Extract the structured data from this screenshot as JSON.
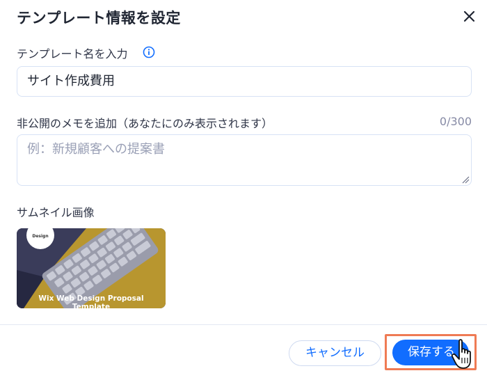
{
  "dialog": {
    "title": "テンプレート情報を設定"
  },
  "name_field": {
    "label": "テンプレート名を入力",
    "value": "サイト作成費用"
  },
  "memo_field": {
    "label": "非公開のメモを追加（あなたにのみ表示されます）",
    "counter": "0/300",
    "placeholder": "例：新規顧客への提案書"
  },
  "thumbnail": {
    "label": "サムネイル画像",
    "logo_text": "Design",
    "caption_line1": "Wix Web Design Proposal",
    "caption_line2": "Template"
  },
  "footer": {
    "cancel_label": "キャンセル",
    "save_label": "保存する"
  },
  "colors": {
    "accent": "#116dff",
    "highlight": "#ef7b54",
    "thumb_yellow": "#b8962f",
    "thumb_navy": "#343755"
  },
  "icons": [
    "close-icon",
    "info-icon",
    "resize-handle-icon",
    "hand-pointer-icon"
  ]
}
